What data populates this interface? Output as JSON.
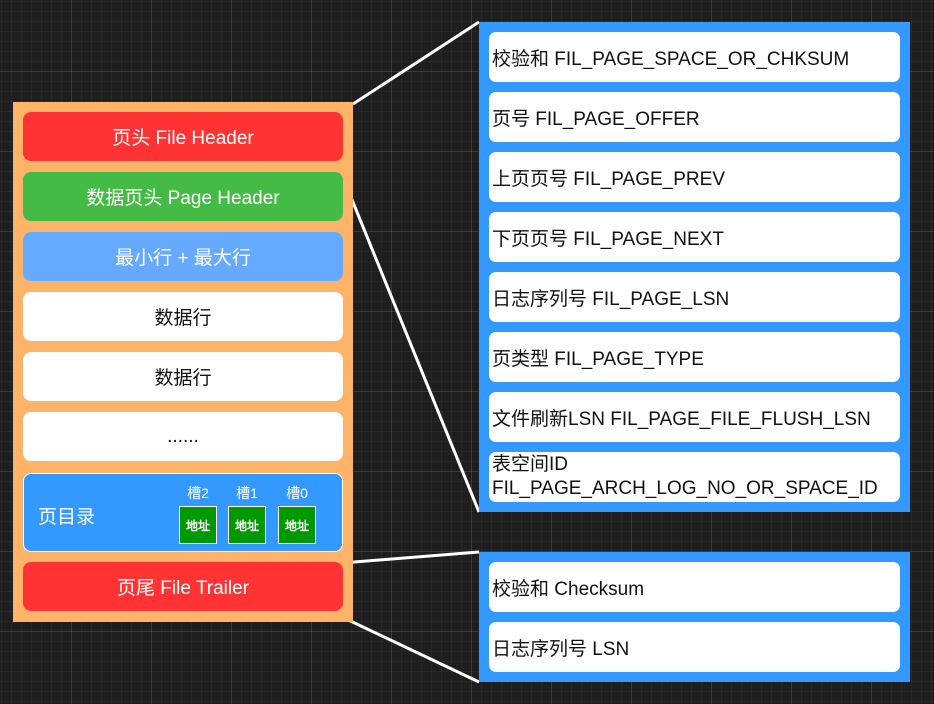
{
  "page": {
    "file_header": "页头 File Header",
    "page_header": "数据页头 Page Header",
    "min_max_rows": "最小行 + 最大行",
    "data_row_1": "数据行",
    "data_row_2": "数据行",
    "ellipsis": "......",
    "directory": {
      "title": "页目录",
      "slots": [
        {
          "label": "槽2",
          "box": "地址"
        },
        {
          "label": "槽1",
          "box": "地址"
        },
        {
          "label": "槽0",
          "box": "地址"
        }
      ]
    },
    "file_trailer": "页尾 File Trailer"
  },
  "file_header_fields": [
    "校验和 FIL_PAGE_SPACE_OR_CHKSUM",
    "页号 FIL_PAGE_OFFER",
    "上页页号 FIL_PAGE_PREV",
    "下页页号 FIL_PAGE_NEXT",
    "日志序列号 FIL_PAGE_LSN",
    "页类型 FIL_PAGE_TYPE",
    "文件刷新LSN FIL_PAGE_FILE_FLUSH_LSN"
  ],
  "space_id_field": {
    "line1": "表空间ID",
    "line2": "FIL_PAGE_ARCH_LOG_NO_OR_SPACE_ID"
  },
  "file_trailer_fields": [
    "校验和 Checksum",
    "日志序列号 LSN"
  ],
  "colors": {
    "page_background": "#fdb469",
    "header_block": "#ff3333",
    "page_header_block": "#44bb44",
    "min_max_block": "#66aaff",
    "directory_block": "#3399ff",
    "slot_box": "#009900",
    "detail_panel": "#3399ff",
    "connector": "#ffffff"
  }
}
